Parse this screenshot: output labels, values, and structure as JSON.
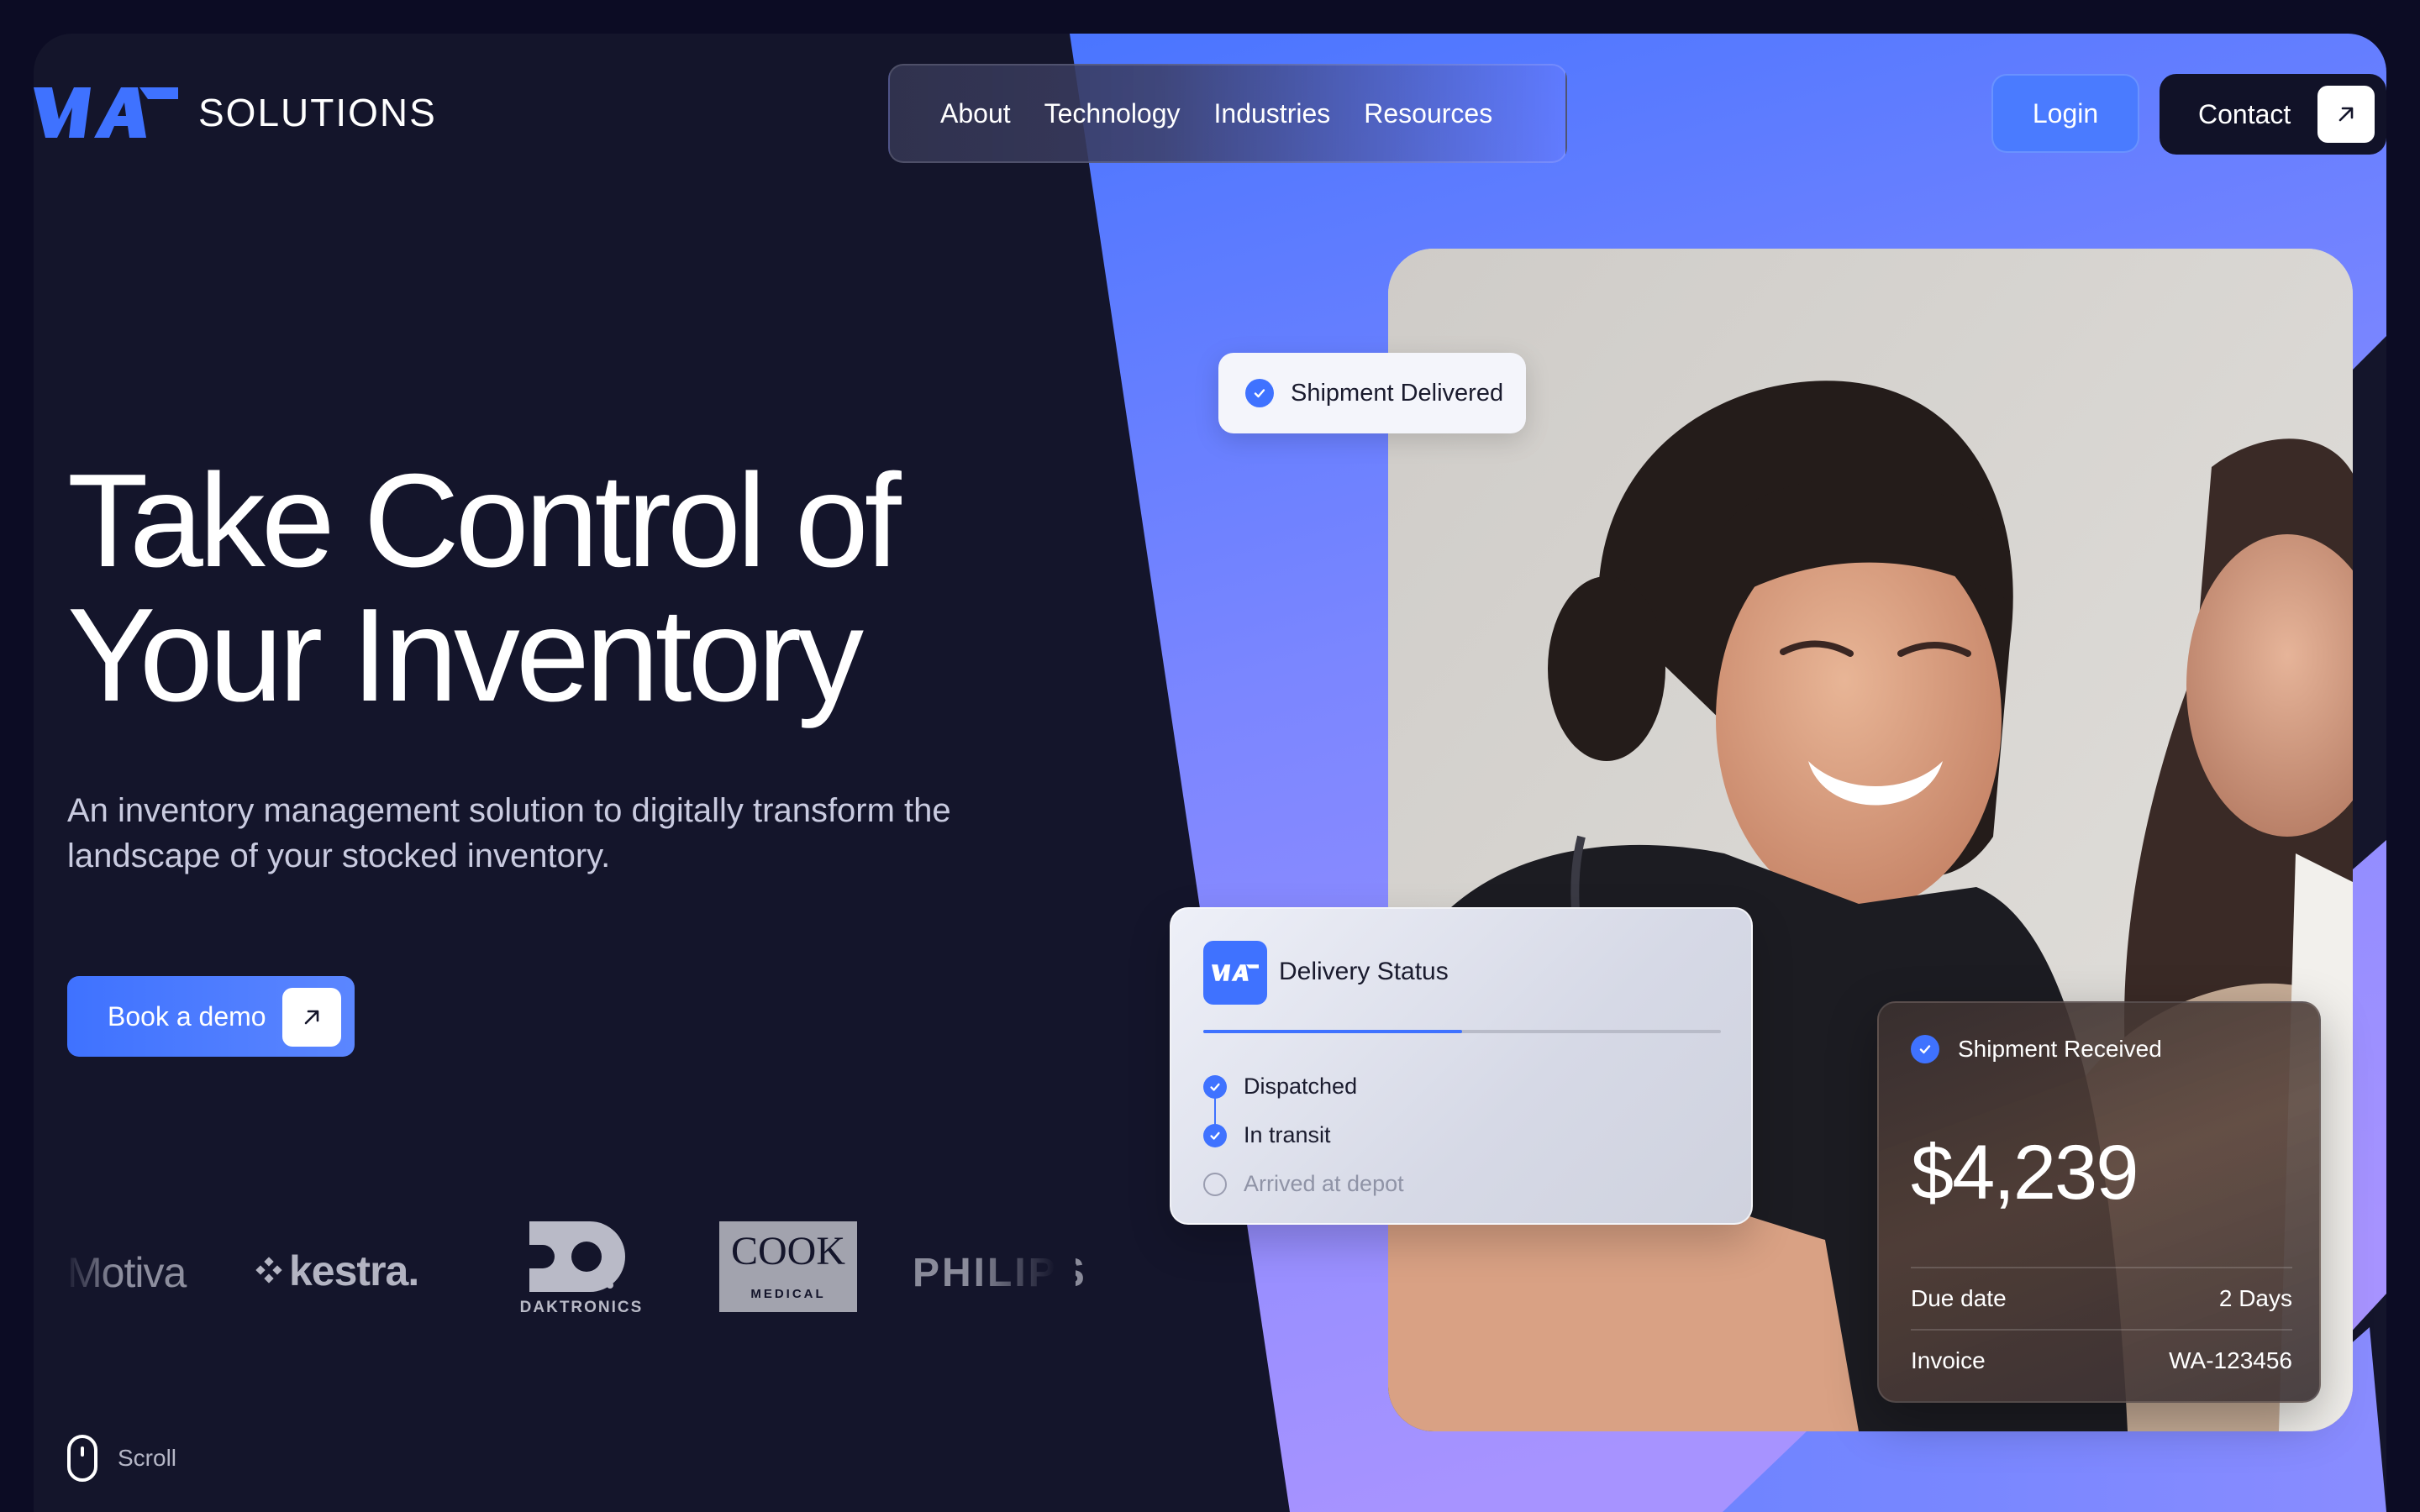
{
  "brand": {
    "name": "SOLUTIONS",
    "logo_icon": "wa-logo-icon"
  },
  "nav": {
    "items": [
      "About",
      "Technology",
      "Industries",
      "Resources"
    ]
  },
  "header": {
    "login_label": "Login",
    "contact_label": "Contact",
    "contact_icon": "arrow-up-right-icon"
  },
  "hero": {
    "title_line1": "Take Control of",
    "title_line2": "Your Inventory",
    "subtitle": "An inventory management solution to digitally transform the landscape of your stocked inventory.",
    "cta_label": "Book a demo",
    "cta_icon": "arrow-up-right-icon"
  },
  "partners": {
    "motiva": "Motiva",
    "kestra": "kestra.",
    "daktronics": "DAKTRONICS",
    "cook": "COOK",
    "cook_sub": "MEDICAL",
    "philips": "PHILIPS"
  },
  "scroll": {
    "label": "Scroll",
    "icon": "mouse-icon"
  },
  "cards": {
    "delivered": {
      "label": "Shipment Delivered"
    },
    "status": {
      "title": "Delivery Status",
      "progress": 0.5,
      "steps": [
        {
          "label": "Dispatched",
          "done": true
        },
        {
          "label": "In transit",
          "done": true
        },
        {
          "label": "Arrived at depot",
          "done": false
        }
      ]
    },
    "received": {
      "label": "Shipment Received",
      "amount": "$4,239",
      "due_label": "Due date",
      "due_value": "2 Days",
      "invoice_label": "Invoice",
      "invoice_value": "WA-123456"
    }
  },
  "colors": {
    "accent": "#3f72ff",
    "background": "#14152b",
    "violet": "#a38cff"
  }
}
